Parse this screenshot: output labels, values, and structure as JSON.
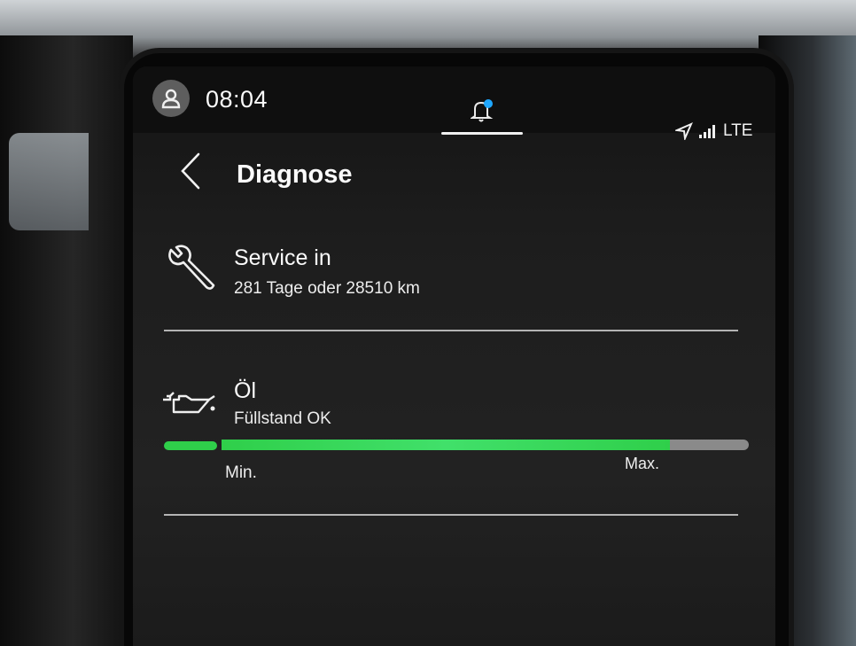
{
  "statusbar": {
    "time": "08:04",
    "network": "LTE",
    "avatar_icon": "user-icon",
    "notification_icon": "bell-icon",
    "location_icon": "navigation-arrow-icon",
    "signal_icon": "signal-bars-icon"
  },
  "header": {
    "back_icon": "chevron-left-icon",
    "title": "Diagnose"
  },
  "items": [
    {
      "icon": "wrench-icon",
      "title": "Service in",
      "subtitle": "281 Tage oder 28510 km"
    },
    {
      "icon": "oil-can-icon",
      "title": "Öl",
      "subtitle": "Füllstand OK"
    }
  ],
  "oil_level": {
    "min_label": "Min.",
    "max_label": "Max.",
    "fill_fraction": 0.85
  },
  "colors": {
    "accent_green": "#2fcf4a",
    "notification_dot": "#1ea7ff",
    "background": "#1c1c1c"
  }
}
